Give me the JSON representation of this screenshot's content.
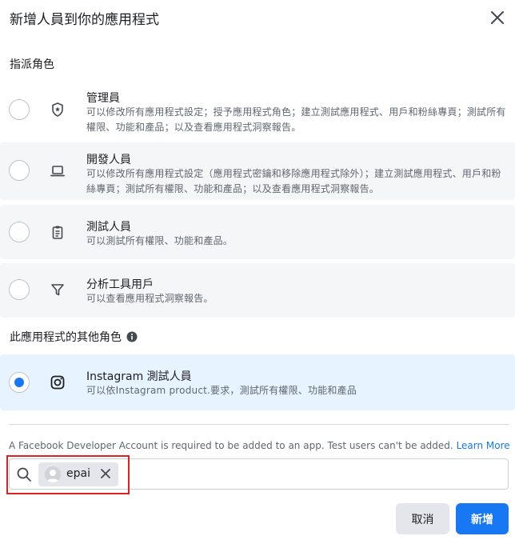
{
  "dialog": {
    "title": "新增人員到你的應用程式",
    "close_icon": "close-icon"
  },
  "assign_role": {
    "label": "指派角色",
    "roles": [
      {
        "name": "管理員",
        "icon": "shield-icon",
        "description": "可以修改所有應用程式設定；授予應用程式角色；建立測試應用程式、用戶和粉絲專頁；測試所有權限、功能和產品；以及查看應用程式洞察報告。",
        "selected": false
      },
      {
        "name": "開發人員",
        "icon": "laptop-icon",
        "description": "可以修改所有應用程式設定（應用程式密鑰和移除應用程式除外）；建立測試應用程式、用戶和粉絲專頁；測試所有權限、功能和產品；以及查看應用程式洞察報告。",
        "selected": false
      },
      {
        "name": "測試人員",
        "icon": "clipboard-icon",
        "description": "可以測試所有權限、功能和產品。",
        "selected": false
      },
      {
        "name": "分析工具用戶",
        "icon": "filter-icon",
        "description": "可以查看應用程式洞察報告。",
        "selected": false
      }
    ]
  },
  "other_roles": {
    "label": "此應用程式的其他角色",
    "info_icon": "info-icon",
    "roles": [
      {
        "name": "Instagram 測試人員",
        "icon": "instagram-icon",
        "description": "可以依Instagram product.要求，測試所有權限、功能和產品",
        "selected": true
      }
    ]
  },
  "notice": {
    "text": "A Facebook Developer Account is required to be added to an app. Test users can't be added.",
    "link": "Learn More"
  },
  "search": {
    "icon": "search-icon",
    "token_label": "epai"
  },
  "buttons": {
    "cancel": "取消",
    "add": "新增"
  },
  "colors": {
    "accent": "#1877f2",
    "selected_bg": "#e7f3ff",
    "shaded_bg": "#f5f6f7",
    "highlight": "#e0201f"
  }
}
